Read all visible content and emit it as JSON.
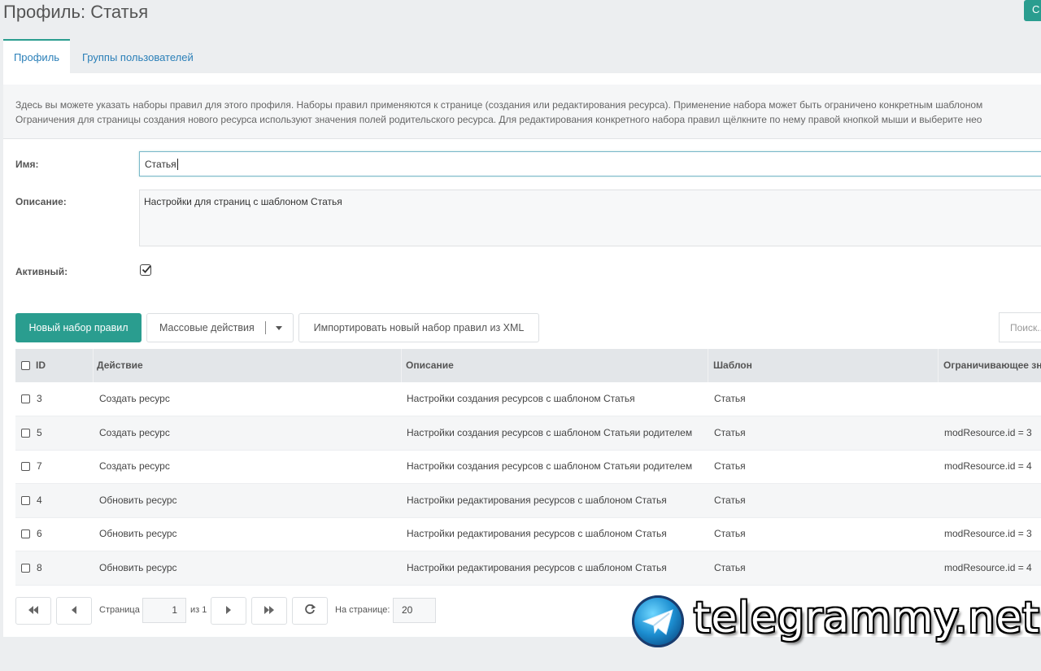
{
  "page": {
    "title": "Профиль: Статья",
    "corner_button": "С"
  },
  "tabs": [
    {
      "label": "Профиль",
      "active": true
    },
    {
      "label": "Группы пользователей",
      "active": false
    }
  ],
  "description_lines": [
    "Здесь вы можете указать наборы правил для этого профиля. Наборы правил применяются к странице (создания или редактирования ресурса). Применение набора может быть ограничено конкретным шаблоном",
    "Ограничения для страницы создания нового ресурса используют значения полей родительского ресурса. Для редактирования конкретного набора правил щёлкните по нему правой кнопкой мыши и выберите нео"
  ],
  "form": {
    "name_label": "Имя:",
    "name_value": "Статья",
    "description_label": "Описание:",
    "description_value": "Настройки для страниц с шаблоном Статья",
    "active_label": "Активный:",
    "active_checked": true
  },
  "toolbar": {
    "new_ruleset": "Новый набор правил",
    "bulk_actions": "Массовые действия",
    "import_xml": "Импортировать новый набор правил из XML",
    "search_placeholder": "Поиск..."
  },
  "grid": {
    "columns": [
      "ID",
      "Действие",
      "Описание",
      "Шаблон",
      "Ограничивающее зн"
    ],
    "rows": [
      {
        "id": "3",
        "action": "Создать ресурс",
        "description": "Настройки создания ресурсов с шаблоном Статья",
        "template": "Статья",
        "constraint": ""
      },
      {
        "id": "5",
        "action": "Создать ресурс",
        "description": "Настройки создания ресурсов с шаблоном Статьяи родителем",
        "template": "Статья",
        "constraint": "modResource.id = 3"
      },
      {
        "id": "7",
        "action": "Создать ресурс",
        "description": "Настройки создания ресурсов с шаблоном Статьяи родителем",
        "template": "Статья",
        "constraint": "modResource.id = 4"
      },
      {
        "id": "4",
        "action": "Обновить ресурс",
        "description": "Настройки редактирования ресурсов с шаблоном Статья",
        "template": "Статья",
        "constraint": ""
      },
      {
        "id": "6",
        "action": "Обновить ресурс",
        "description": "Настройки редактирования ресурсов с шаблоном Статья",
        "template": "Статья",
        "constraint": "modResource.id = 3"
      },
      {
        "id": "8",
        "action": "Обновить ресурс",
        "description": "Настройки редактирования ресурсов с шаблоном Статья",
        "template": "Статья",
        "constraint": "modResource.id = 4"
      }
    ]
  },
  "pager": {
    "page_label": "Страница",
    "page_value": "1",
    "of_label": "из 1",
    "per_page_label": "На странице:",
    "per_page_value": "20"
  },
  "watermark": {
    "text": "telegrammy.net"
  },
  "colors": {
    "accent": "#2a9d8f",
    "link": "#2a7fb8",
    "background": "#eceef0"
  }
}
